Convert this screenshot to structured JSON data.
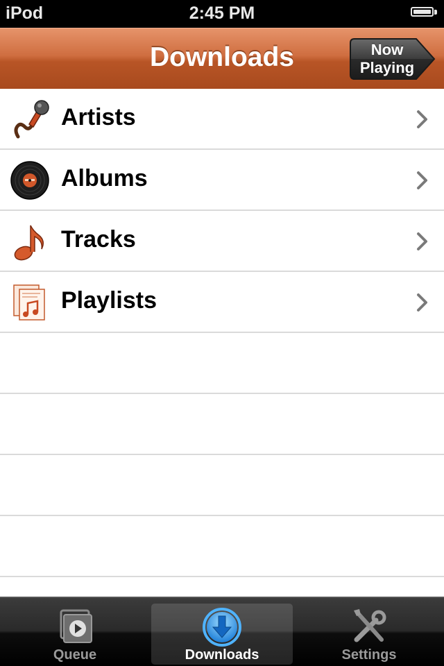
{
  "status_bar": {
    "carrier": "iPod",
    "time": "2:45 PM",
    "battery": "full"
  },
  "nav_bar": {
    "title": "Downloads",
    "now_playing_line1": "Now",
    "now_playing_line2": "Playing",
    "color": "#b85526"
  },
  "list": {
    "items": [
      {
        "label": "Artists",
        "icon": "microphone-icon"
      },
      {
        "label": "Albums",
        "icon": "vinyl-record-icon"
      },
      {
        "label": "Tracks",
        "icon": "music-note-icon"
      },
      {
        "label": "Playlists",
        "icon": "playlist-document-icon"
      }
    ]
  },
  "tab_bar": {
    "tabs": [
      {
        "label": "Queue",
        "icon": "queue-video-icon",
        "selected": false
      },
      {
        "label": "Downloads",
        "icon": "download-arrow-icon",
        "selected": true
      },
      {
        "label": "Settings",
        "icon": "tools-wrench-screwdriver-icon",
        "selected": false
      }
    ]
  }
}
